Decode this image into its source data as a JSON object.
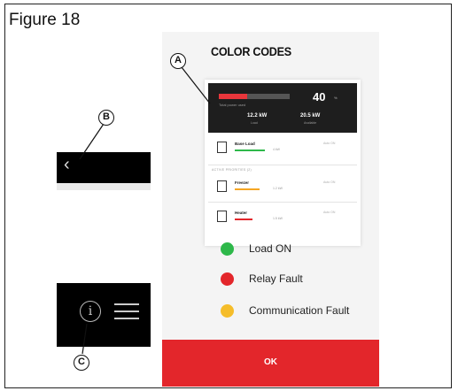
{
  "figure": {
    "title": "Figure 18"
  },
  "screen": {
    "title": "COLOR CODES",
    "summary": {
      "bar_fraction": 0.4,
      "bar_label": "Total power used",
      "value": "40",
      "unit": "%",
      "stat_left": "12.2 kW",
      "stat_left_sub": "Load",
      "stat_right": "20.5 kW",
      "stat_right_sub": "Available"
    },
    "loads": [
      {
        "name": "Base Load",
        "line_color": "#2eb84a",
        "line_fraction": 0.85,
        "value": "4 kW",
        "right": "Auto ON",
        "icon": "water-heater-icon"
      },
      {
        "name": "Freezer",
        "line_color": "#f5a623",
        "line_fraction": 0.7,
        "value": "1.2 kW",
        "right": "Auto ON",
        "icon": "freezer-icon"
      },
      {
        "name": "Heater",
        "line_color": "#e3262b",
        "line_fraction": 0.5,
        "value": "1.5 kW",
        "right": "Auto ON",
        "icon": "heater-icon"
      }
    ],
    "section_label": "ACTIVE PRIORITIES (2)",
    "legend": [
      {
        "label": "Load ON",
        "color": "#2eb84a"
      },
      {
        "label": "Relay Fault",
        "color": "#e3262b"
      },
      {
        "label": "Communication Fault",
        "color": "#f5bd2a"
      }
    ],
    "ok_label": "OK"
  },
  "callouts": {
    "a": "A",
    "b": "B",
    "c": "C"
  },
  "inset_b": {
    "icon": "back-chevron-icon",
    "glyph": "‹"
  },
  "inset_c": {
    "info_icon": "info-icon",
    "glyph": "i",
    "menu_icon": "hamburger-menu-icon"
  }
}
